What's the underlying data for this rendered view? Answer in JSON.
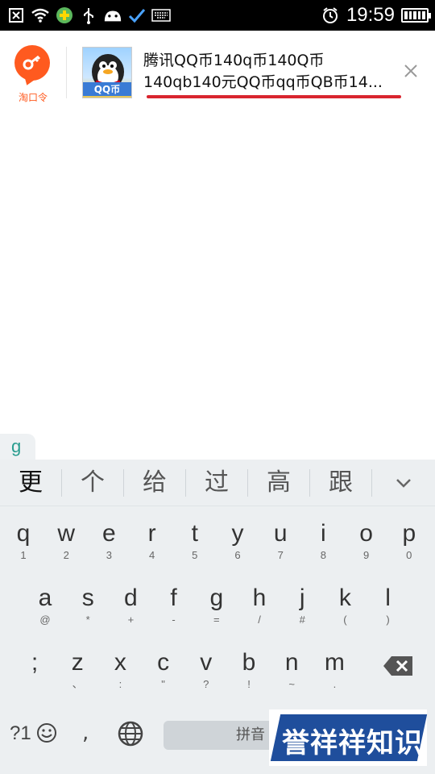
{
  "status_bar": {
    "time": "19:59",
    "icons": [
      "close-box-icon",
      "wifi-icon",
      "game-icon",
      "usb-icon",
      "android-icon",
      "check-icon",
      "keyboard-icon",
      "alarm-icon",
      "battery-icon"
    ]
  },
  "notification": {
    "app_label": "淘口令",
    "thumbnail_tag": "QQ币",
    "title_line1": "腾讯QQ币140q币140Q币",
    "title_line2": "140qb140元QQ币qq币QB币14...",
    "accent_color": "#ff5a1f",
    "underline_color": "#d9252f"
  },
  "input": {
    "composing": "g"
  },
  "keyboard": {
    "candidates": [
      "更",
      "个",
      "给",
      "过",
      "高",
      "跟"
    ],
    "rows": [
      [
        {
          "main": "q",
          "sub": "1"
        },
        {
          "main": "w",
          "sub": "2"
        },
        {
          "main": "e",
          "sub": "3"
        },
        {
          "main": "r",
          "sub": "4"
        },
        {
          "main": "t",
          "sub": "5"
        },
        {
          "main": "y",
          "sub": "6"
        },
        {
          "main": "u",
          "sub": "7"
        },
        {
          "main": "i",
          "sub": "8"
        },
        {
          "main": "o",
          "sub": "9"
        },
        {
          "main": "p",
          "sub": "0"
        }
      ],
      [
        {
          "main": "a",
          "sub": "@"
        },
        {
          "main": "s",
          "sub": "*"
        },
        {
          "main": "d",
          "sub": "+"
        },
        {
          "main": "f",
          "sub": "-"
        },
        {
          "main": "g",
          "sub": "="
        },
        {
          "main": "h",
          "sub": "/"
        },
        {
          "main": "j",
          "sub": "#"
        },
        {
          "main": "k",
          "sub": "("
        },
        {
          "main": "l",
          "sub": ")"
        }
      ],
      [
        {
          "main": ";",
          "sub": ""
        },
        {
          "main": "z",
          "sub": "、"
        },
        {
          "main": "x",
          "sub": ":"
        },
        {
          "main": "c",
          "sub": "\""
        },
        {
          "main": "v",
          "sub": "?"
        },
        {
          "main": "b",
          "sub": "!"
        },
        {
          "main": "n",
          "sub": "~"
        },
        {
          "main": "m",
          "sub": "."
        }
      ]
    ],
    "symbol_key": "?1",
    "comma_key": ",",
    "space_label": "拼音"
  },
  "watermark": {
    "text": "誉祥祥知识"
  }
}
